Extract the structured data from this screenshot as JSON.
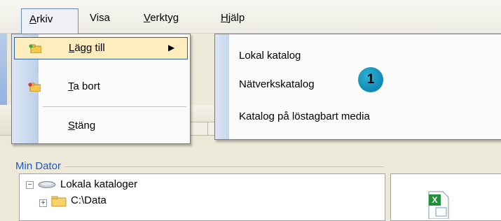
{
  "menubar": {
    "items": [
      {
        "label": "Arkiv",
        "mnemonic_index": 0,
        "active": true
      },
      {
        "label": "Visa"
      },
      {
        "label": "Verktyg",
        "mnemonic_index": 0
      },
      {
        "label": "Hjälp",
        "mnemonic_index": 0
      }
    ]
  },
  "arkiv_menu": {
    "items": [
      {
        "label": "Lägg till",
        "icon": "folder-add-icon",
        "has_submenu": true,
        "highlighted": true
      },
      {
        "label": "Ta bort",
        "icon": "folder-remove-icon"
      },
      {
        "label": "Stäng"
      }
    ]
  },
  "submenu": {
    "items": [
      {
        "label": "Lokal katalog"
      },
      {
        "label": "Nätverkskatalog"
      },
      {
        "label": "Katalog på löstagbart media"
      }
    ]
  },
  "callout": {
    "number": "1"
  },
  "panel": {
    "group_label": "Min Dator",
    "tree": [
      {
        "label": "Lokala kataloger",
        "icon": "drive-icon",
        "expanded": true
      },
      {
        "label": "C:\\Data",
        "icon": "folder-icon",
        "expanded": false
      }
    ],
    "file_icon": "excel-file-icon"
  },
  "colors": {
    "menu_highlight": "#ffeebd",
    "menu_highlight_border": "#3160a5",
    "group_label": "#1f56c8",
    "callout": "#1a9cc8"
  }
}
